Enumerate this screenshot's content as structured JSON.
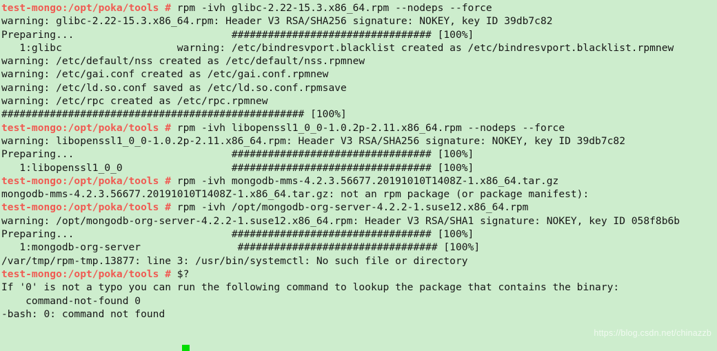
{
  "terminal": {
    "background_color": "#cdedcd",
    "prompt_color": "#f05a52",
    "text_color": "#161616",
    "cursor_color": "#00dd00",
    "prompt_string": "test-mongo:/opt/poka/tools #",
    "lines": [
      {
        "type": "command",
        "prompt": "test-mongo:/opt/poka/tools #",
        "text": " rpm -ivh glibc-2.22-15.3.x86_64.rpm --nodeps --force"
      },
      {
        "type": "output",
        "text": "warning: glibc-2.22-15.3.x86_64.rpm: Header V3 RSA/SHA256 signature: NOKEY, key ID 39db7c82"
      },
      {
        "type": "output",
        "text": "Preparing...                          ################################# [100%]"
      },
      {
        "type": "output",
        "text": "   1:glibc                   warning: /etc/bindresvport.blacklist created as /etc/bindresvport.blacklist.rpmnew"
      },
      {
        "type": "output",
        "text": "warning: /etc/default/nss created as /etc/default/nss.rpmnew"
      },
      {
        "type": "output",
        "text": "warning: /etc/gai.conf created as /etc/gai.conf.rpmnew"
      },
      {
        "type": "output",
        "text": "warning: /etc/ld.so.conf saved as /etc/ld.so.conf.rpmsave"
      },
      {
        "type": "output",
        "text": "warning: /etc/rpc created as /etc/rpc.rpmnew"
      },
      {
        "type": "output",
        "text": "################################################## [100%]"
      },
      {
        "type": "command",
        "prompt": "test-mongo:/opt/poka/tools #",
        "text": " rpm -ivh libopenssl1_0_0-1.0.2p-2.11.x86_64.rpm --nodeps --force"
      },
      {
        "type": "output",
        "text": "warning: libopenssl1_0_0-1.0.2p-2.11.x86_64.rpm: Header V3 RSA/SHA256 signature: NOKEY, key ID 39db7c82"
      },
      {
        "type": "output",
        "text": "Preparing...                          ################################# [100%]"
      },
      {
        "type": "output",
        "text": "   1:libopenssl1_0_0                  ################################# [100%]"
      },
      {
        "type": "command",
        "prompt": "test-mongo:/opt/poka/tools #",
        "text": " rpm -ivh mongodb-mms-4.2.3.56677.20191010T1408Z-1.x86_64.tar.gz"
      },
      {
        "type": "output",
        "text": "mongodb-mms-4.2.3.56677.20191010T1408Z-1.x86_64.tar.gz: not an rpm package (or package manifest):"
      },
      {
        "type": "command",
        "prompt": "test-mongo:/opt/poka/tools #",
        "text": " rpm -ivh /opt/mongodb-org-server-4.2.2-1.suse12.x86_64.rpm"
      },
      {
        "type": "output",
        "text": "warning: /opt/mongodb-org-server-4.2.2-1.suse12.x86_64.rpm: Header V3 RSA/SHA1 signature: NOKEY, key ID 058f8b6b"
      },
      {
        "type": "output",
        "text": "Preparing...                          ################################# [100%]"
      },
      {
        "type": "output",
        "text": "   1:mongodb-org-server                ################################# [100%]"
      },
      {
        "type": "output",
        "text": "/var/tmp/rpm-tmp.13877: line 3: /usr/bin/systemctl: No such file or directory"
      },
      {
        "type": "command",
        "prompt": "test-mongo:/opt/poka/tools #",
        "text": " $?"
      },
      {
        "type": "output",
        "text": "If '0' is not a typo you can run the following command to lookup the package that contains the binary:"
      },
      {
        "type": "output",
        "text": "    command-not-found 0"
      },
      {
        "type": "output",
        "text": "-bash: 0: command not found"
      }
    ],
    "watermark": "https://blog.csdn.net/chinazzb"
  }
}
